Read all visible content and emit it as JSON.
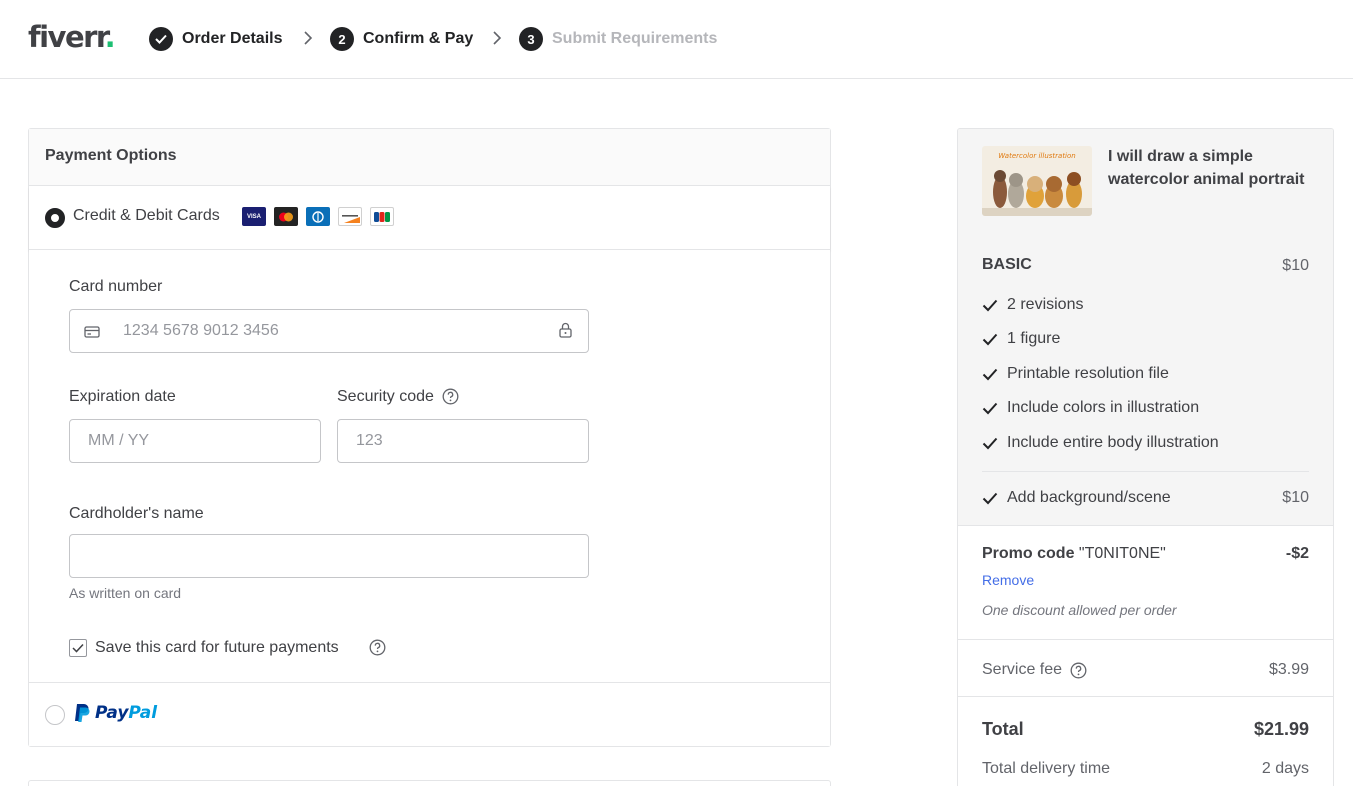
{
  "header": {
    "logo_text": "fiverr",
    "logo_dot": ".",
    "steps": [
      {
        "num": "1",
        "label": "Order Details",
        "state": "done"
      },
      {
        "num": "2",
        "label": "Confirm & Pay",
        "state": "active"
      },
      {
        "num": "3",
        "label": "Submit Requirements",
        "state": "upcoming"
      }
    ]
  },
  "payment": {
    "title": "Payment Options",
    "card_option_label": "Credit & Debit Cards",
    "card_brands": [
      "VISA",
      "MC",
      "Diners",
      "Discover",
      "JCB"
    ],
    "card_number": {
      "label": "Card number",
      "placeholder": "1234 5678 9012 3456",
      "value": ""
    },
    "expiration": {
      "label": "Expiration date",
      "placeholder": "MM / YY",
      "value": ""
    },
    "security": {
      "label": "Security code",
      "placeholder": "123",
      "value": ""
    },
    "cardholder": {
      "label": "Cardholder's name",
      "value": "",
      "hint": "As written on card"
    },
    "save_card": {
      "label": "Save this card for future payments",
      "checked": true
    },
    "paypal": {
      "part1": "Pay",
      "part2": "Pal"
    }
  },
  "summary": {
    "gig_title": "I will draw a simple watercolor animal portrait",
    "gig_thumb_text": "Watercolor illustration",
    "package": {
      "name": "BASIC",
      "price": "$10"
    },
    "features": [
      "2 revisions",
      "1 figure",
      "Printable resolution file",
      "Include colors in illustration",
      "Include entire body illustration"
    ],
    "extra": {
      "label": "Add background/scene",
      "price": "$10"
    },
    "promo": {
      "label": "Promo code",
      "code": "\"T0NIT0NE\"",
      "value": "-$2",
      "remove": "Remove",
      "note": "One discount allowed per order"
    },
    "service_fee": {
      "label": "Service fee",
      "value": "$3.99"
    },
    "total": {
      "label": "Total",
      "value": "$21.99"
    },
    "delivery": {
      "label": "Total delivery time",
      "value": "2 days"
    }
  },
  "colors": {
    "brand_green": "#1dbf73",
    "link_blue": "#446ee7",
    "text_dark": "#404145"
  }
}
